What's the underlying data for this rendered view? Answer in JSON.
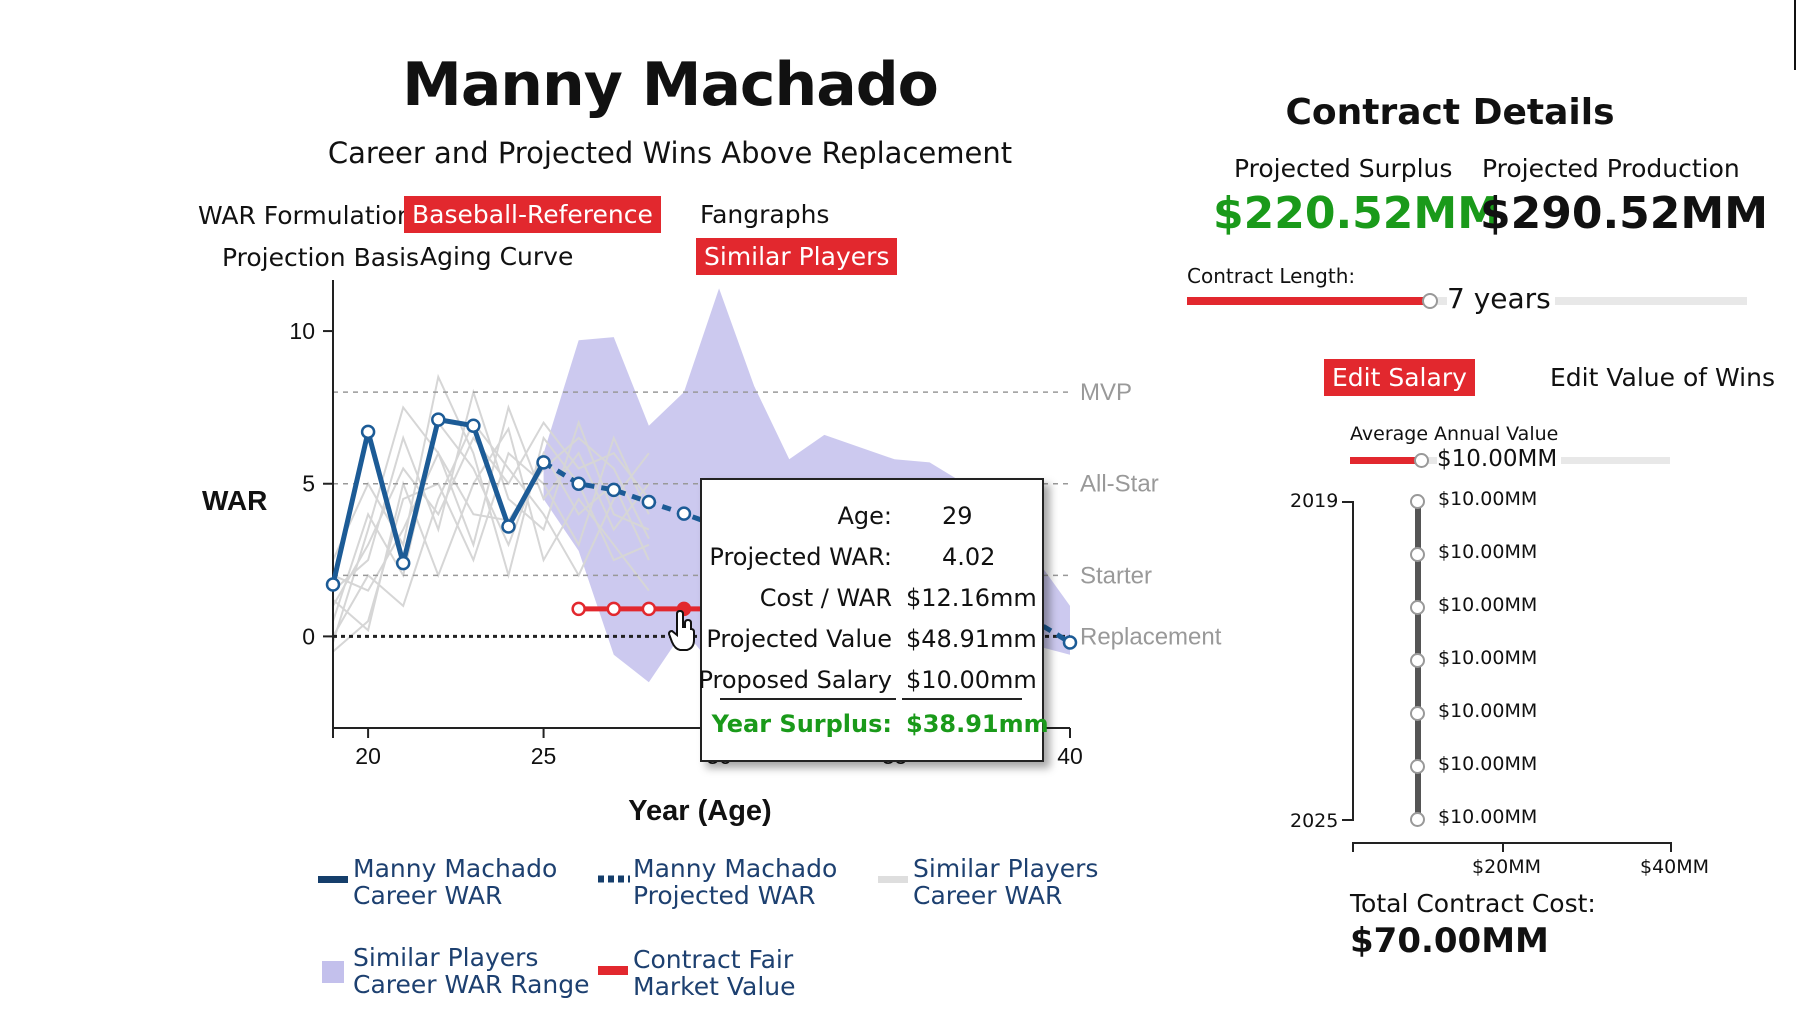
{
  "header": {
    "title": "Manny Machado",
    "subtitle": "Career and Projected Wins Above Replacement"
  },
  "controls": {
    "war_label": "WAR Formulation:",
    "war_options": [
      "Baseball-Reference",
      "Fangraphs"
    ],
    "war_selected": "Baseball-Reference",
    "basis_label": "Projection Basis",
    "basis_options": [
      "Aging Curve",
      "Similar Players"
    ],
    "basis_selected": "Similar Players"
  },
  "chart_data": {
    "type": "line",
    "ylabel": "WAR",
    "xlabel": "Year (Age)",
    "x_ticks": [
      20,
      25,
      30,
      35,
      40
    ],
    "y_ticks": [
      0,
      5,
      10
    ],
    "xlim": [
      19,
      40
    ],
    "ylim": [
      -3,
      12
    ],
    "reference_lines": [
      {
        "label": "MVP",
        "value": 8
      },
      {
        "label": "All-Star",
        "value": 5
      },
      {
        "label": "Starter",
        "value": 2
      },
      {
        "label": "Replacement",
        "value": 0
      }
    ],
    "series": [
      {
        "name": "Manny Machado Career WAR",
        "style": "solid",
        "color": "#1c5b96",
        "x": [
          19,
          20,
          21,
          22,
          23,
          24,
          25
        ],
        "y": [
          1.7,
          6.7,
          2.4,
          7.1,
          6.9,
          3.6,
          5.7
        ]
      },
      {
        "name": "Manny Machado Projected WAR",
        "style": "dotted",
        "color": "#1c5b96",
        "x": [
          25,
          26,
          27,
          28,
          29,
          30,
          31,
          32,
          33,
          34,
          35,
          36,
          37,
          38,
          39,
          40
        ],
        "y": [
          5.7,
          5.0,
          4.8,
          4.4,
          4.02,
          3.6,
          3.3,
          3.0,
          2.7,
          2.4,
          2.0,
          1.6,
          1.2,
          0.9,
          0.5,
          -0.2
        ]
      },
      {
        "name": "Contract Fair Market Value",
        "style": "solid",
        "color": "#e2282e",
        "x": [
          26,
          27,
          28,
          29,
          30,
          31,
          32
        ],
        "y": [
          0.9,
          0.9,
          0.9,
          0.9,
          0.9,
          0.9,
          0.9
        ]
      }
    ],
    "range_band": {
      "name": "Similar Players Career WAR Range",
      "color": "#c3c0ec",
      "x": [
        25,
        26,
        27,
        28,
        29,
        30,
        31,
        32,
        33,
        34,
        35,
        36,
        37,
        38,
        39,
        40
      ],
      "upper": [
        6.0,
        9.7,
        9.8,
        6.9,
        8.0,
        11.4,
        8.2,
        5.8,
        6.6,
        6.2,
        5.8,
        5.7,
        5.0,
        4.0,
        2.6,
        1.0
      ],
      "lower": [
        4.5,
        2.8,
        -0.6,
        -1.5,
        0.2,
        -1.2,
        -0.8,
        -0.4,
        0.2,
        0.6,
        0.6,
        0.2,
        0.1,
        0.1,
        -0.3,
        -0.6
      ]
    },
    "similar_players": {
      "name": "Similar Players Career WAR",
      "color": "#d6d6d6",
      "x": [
        19,
        20,
        21,
        22,
        23,
        24,
        25,
        26,
        27,
        28
      ],
      "lines": [
        [
          1.0,
          3.0,
          5.5,
          4.0,
          6.5,
          5.0,
          7.0,
          5.5,
          6.0,
          4.5
        ],
        [
          2.0,
          1.5,
          3.5,
          6.0,
          3.0,
          7.5,
          4.5,
          6.0,
          3.5,
          5.0
        ],
        [
          0.5,
          4.0,
          2.0,
          7.0,
          5.5,
          3.0,
          6.0,
          4.0,
          5.0,
          2.5
        ],
        [
          1.5,
          2.5,
          6.5,
          3.5,
          8.0,
          4.5,
          3.5,
          7.0,
          4.0,
          3.5
        ],
        [
          -0.5,
          0.5,
          4.5,
          5.0,
          2.5,
          6.0,
          5.0,
          3.0,
          6.5,
          4.0
        ],
        [
          2.5,
          5.0,
          3.0,
          8.5,
          6.0,
          2.0,
          6.5,
          5.0,
          2.5,
          3.0
        ],
        [
          0.0,
          2.0,
          1.0,
          4.5,
          7.0,
          5.5,
          4.0,
          2.0,
          4.5,
          6.0
        ],
        [
          1.2,
          0.2,
          5.0,
          2.0,
          5.0,
          6.8,
          2.5,
          4.5,
          3.0,
          1.5
        ],
        [
          -0.2,
          3.5,
          7.5,
          6.0,
          4.0,
          3.8,
          5.5,
          6.5,
          5.5,
          3.2
        ]
      ]
    },
    "tooltip": {
      "age_label": "Age:",
      "age": "29",
      "war_label": "Projected WAR:",
      "war": "4.02",
      "cost_label": "Cost / WAR",
      "cost": "$12.16mm",
      "value_label": "Projected Value",
      "value": "$48.91mm",
      "salary_label": "Proposed Salary",
      "salary": "$10.00mm",
      "surplus_label": "Year Surplus:",
      "surplus": "$38.91mm"
    }
  },
  "legend": {
    "career": [
      "Manny Machado",
      "Career WAR"
    ],
    "projected": [
      "Manny Machado",
      "Projected WAR"
    ],
    "similar": [
      "Similar Players",
      "Career WAR"
    ],
    "range": [
      "Similar Players",
      "Career WAR Range"
    ],
    "fmv": [
      "Contract Fair",
      "Market Value"
    ]
  },
  "contract": {
    "title": "Contract Details",
    "surplus_label": "Projected Surplus",
    "surplus_value": "$220.52MM",
    "production_label": "Projected Production",
    "production_value": "$290.52MM",
    "length_label": "Contract Length:",
    "length_value": "7 years",
    "length_fraction": 0.43,
    "edit_salary": "Edit Salary",
    "edit_wins": "Edit Value of Wins",
    "aav_label": "Average Annual Value",
    "aav_value": "$10.00MM",
    "aav_fraction": 0.22,
    "salary_years": [
      "2019",
      "2025"
    ],
    "salaries": [
      "$10.00MM",
      "$10.00MM",
      "$10.00MM",
      "$10.00MM",
      "$10.00MM",
      "$10.00MM",
      "$10.00MM"
    ],
    "salary_axis_ticks": [
      "$20MM",
      "$40MM"
    ],
    "total_label": "Total Contract Cost:",
    "total_value": "$70.00MM",
    "accent_red": "#e2282e",
    "surplus_green": "#1a9a1a"
  }
}
